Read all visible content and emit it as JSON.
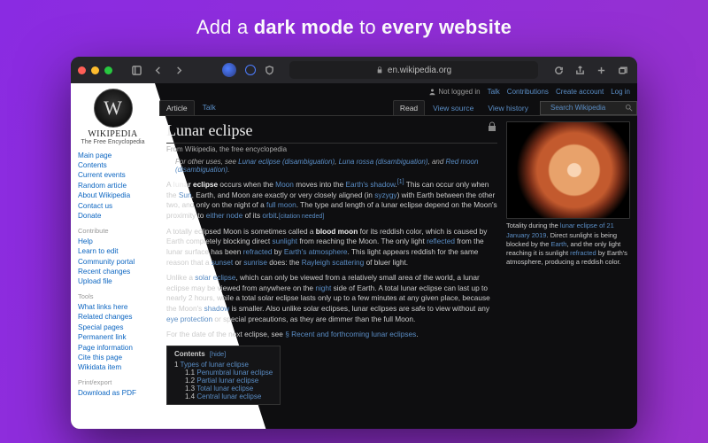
{
  "headline": {
    "pre": "Add a ",
    "b1": "dark mode",
    "mid": " to ",
    "b2": "every website"
  },
  "browser": {
    "url_host": "en.wikipedia.org"
  },
  "toprow": {
    "not_logged_in": "Not logged in",
    "talk": "Talk",
    "contributions": "Contributions",
    "create_account": "Create account",
    "log_in": "Log in"
  },
  "tabs_left": {
    "article": "Article",
    "talk": "Talk"
  },
  "tabs_right": {
    "read": "Read",
    "view_source": "View source",
    "view_history": "View history"
  },
  "search": {
    "placeholder": "Search Wikipedia"
  },
  "logo": {
    "name": "WIKIPEDIA",
    "sub": "The Free Encyclopedia"
  },
  "sidebar": {
    "main": [
      "Main page",
      "Contents",
      "Current events",
      "Random article",
      "About Wikipedia",
      "Contact us",
      "Donate"
    ],
    "contribute_h": "Contribute",
    "contribute": [
      "Help",
      "Learn to edit",
      "Community portal",
      "Recent changes",
      "Upload file"
    ],
    "tools_h": "Tools",
    "tools": [
      "What links here",
      "Related changes",
      "Special pages",
      "Permanent link",
      "Page information",
      "Cite this page",
      "Wikidata item"
    ],
    "print_h": "Print/export",
    "print": [
      "Download as PDF"
    ]
  },
  "article": {
    "title": "Lunar eclipse",
    "from": "From Wikipedia, the free encyclopedia",
    "hatnote_pre": "For other uses, see ",
    "hat_links": [
      "Lunar eclipse (disambiguation)",
      "Luna rossa (disambiguation)",
      "Red moon (disambiguation)"
    ],
    "hat_and": ", and ",
    "p1": {
      "t1": "A ",
      "b1": "lunar eclipse",
      "t2": " occurs when the ",
      "a1": "Moon",
      "t3": " moves into the ",
      "a2": "Earth's shadow",
      "ref": "[1]",
      "t4": " This can occur only when the ",
      "a3": "Sun",
      "t5": ", Earth, and Moon are exactly or very closely aligned (in ",
      "a4": "syzygy",
      "t6": ") with Earth between the other two, and only on the night of a ",
      "a5": "full moon",
      "t7": ". The type and length of a lunar eclipse depend on the Moon's proximity to ",
      "a6": "either node",
      "t8": " of its ",
      "a7": "orbit",
      "t9": ".",
      "cn": "[citation needed]"
    },
    "p2": {
      "t1": "A totally eclipsed Moon is sometimes called a ",
      "b1": "blood moon",
      "t2": " for its reddish color, which is caused by Earth completely blocking direct ",
      "a1": "sunlight",
      "t3": " from reaching the Moon. The only light ",
      "a2": "reflected",
      "t4": " from the lunar surface has been ",
      "a3": "refracted",
      "t5": " by ",
      "a4": "Earth's atmosphere",
      "t6": ". This light appears reddish for the same reason that a ",
      "a5": "sunset",
      "t7": " or ",
      "a6": "sunrise",
      "t8": " does: the ",
      "a7": "Rayleigh scattering",
      "t9": " of bluer light."
    },
    "p3": {
      "t1": "Unlike a ",
      "a1": "solar eclipse",
      "t2": ", which can only be viewed from a relatively small area of the world, a lunar eclipse may be viewed from anywhere on the ",
      "a2": "night",
      "t3": " side of Earth. A total lunar eclipse can last up to nearly 2 hours, while a total solar eclipse lasts only up to a few minutes at any given place, because the Moon's ",
      "a3": "shadow",
      "t4": " is smaller. Also unlike solar eclipses, lunar eclipses are safe to view without any ",
      "a4": "eye protection",
      "t5": " or special precautions, as they are dimmer than the full Moon."
    },
    "p4": {
      "t1": "For the date of the next eclipse, see ",
      "a1": "§ Recent and forthcoming lunar eclipses",
      "t2": "."
    },
    "toc_title": "Contents",
    "toc_hide": "[hide]",
    "toc": [
      {
        "n": "1",
        "t": "Types of lunar eclipse",
        "lvl": 1
      },
      {
        "n": "1.1",
        "t": "Penumbral lunar eclipse",
        "lvl": 2
      },
      {
        "n": "1.2",
        "t": "Partial lunar eclipse",
        "lvl": 2
      },
      {
        "n": "1.3",
        "t": "Total lunar eclipse",
        "lvl": 2
      },
      {
        "n": "1.4",
        "t": "Central lunar eclipse",
        "lvl": 2
      }
    ]
  },
  "infobox": {
    "cap_t1": "Totality during the ",
    "a1": "lunar eclipse of 21 January 2019",
    "t2": ". Direct sunlight is being blocked by the ",
    "a2": "Earth",
    "t3": ", and the only light reaching it is sunlight ",
    "a3": "refracted",
    "t4": " by Earth's atmosphere, producing a reddish color."
  }
}
